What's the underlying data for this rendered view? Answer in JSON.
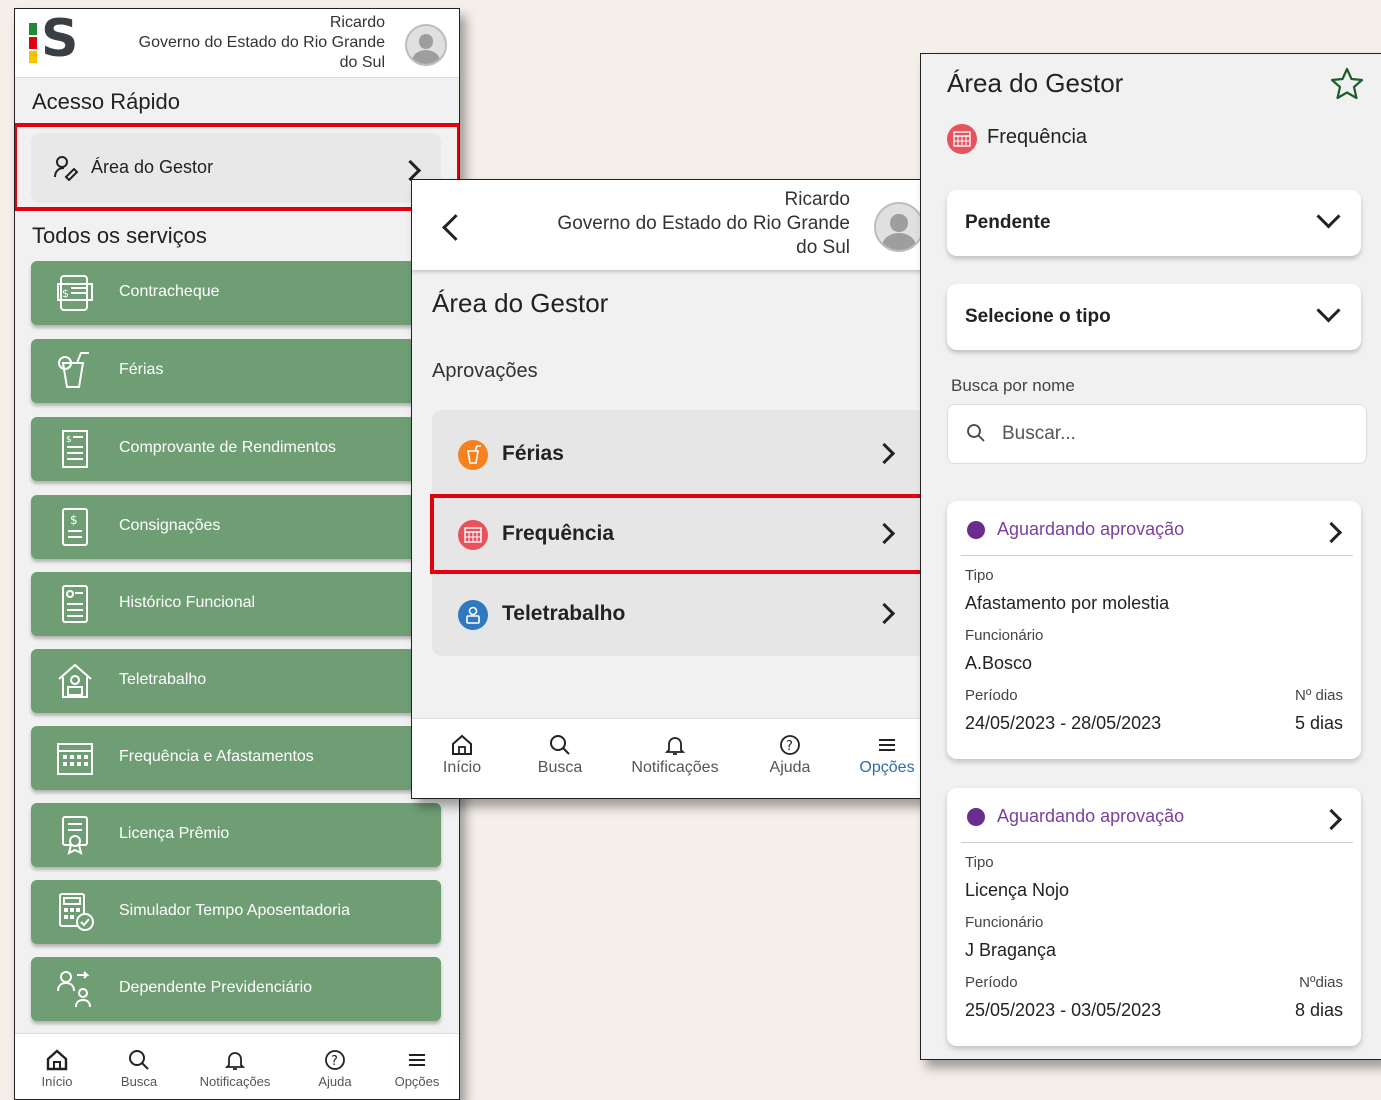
{
  "colors": {
    "service_green": "#6f9e75",
    "highlight_red": "#e3000f",
    "pending_purple": "#7b3fa0",
    "ferias_orange": "#f5821f",
    "frequencia_red": "#e8525c",
    "teletrabalho_blue": "#2e79c0"
  },
  "header": {
    "user_name": "Ricardo",
    "org_line1": "Governo do Estado do Rio Grande",
    "org_line2": "do Sul"
  },
  "home": {
    "quick_access_title": "Acesso Rápido",
    "quick_access_item": "Área do Gestor",
    "services_title": "Todos os serviços",
    "services": [
      {
        "label": "Contracheque",
        "icon": "paycheck-icon"
      },
      {
        "label": "Férias",
        "icon": "drink-icon"
      },
      {
        "label": "Comprovante de Rendimentos",
        "icon": "receipt-icon"
      },
      {
        "label": "Consignações",
        "icon": "dollar-document-icon"
      },
      {
        "label": "Histórico Funcional",
        "icon": "history-document-icon"
      },
      {
        "label": "Teletrabalho",
        "icon": "home-worker-icon"
      },
      {
        "label": "Frequência e Afastamentos",
        "icon": "calendar-icon"
      },
      {
        "label": "Licença Prêmio",
        "icon": "certificate-icon"
      },
      {
        "label": "Simulador Tempo Aposentadoria",
        "icon": "calculator-icon"
      },
      {
        "label": "Dependente Previdenciário",
        "icon": "dependents-icon"
      }
    ]
  },
  "nav": {
    "inicio": "Início",
    "busca": "Busca",
    "notificacoes": "Notificações",
    "ajuda": "Ajuda",
    "opcoes": "Opções"
  },
  "gestor": {
    "title": "Área do Gestor",
    "approvals_title": "Aprovações",
    "approvals": [
      {
        "label": "Férias",
        "icon": "drink-icon"
      },
      {
        "label": "Frequência",
        "icon": "calendar-icon"
      },
      {
        "label": "Teletrabalho",
        "icon": "home-worker-icon"
      }
    ]
  },
  "frequencia": {
    "title": "Área do Gestor",
    "subtitle": "Frequência",
    "status_dropdown": "Pendente",
    "type_dropdown": "Selecione o tipo",
    "search_label": "Busca por nome",
    "search_placeholder": "Buscar...",
    "labels": {
      "tipo": "Tipo",
      "funcionario": "Funcionário",
      "periodo": "Período"
    },
    "cards": [
      {
        "status": "Aguardando aprovação",
        "tipo": "Afastamento por molestia",
        "funcionario": "A.Bosco",
        "periodo": "24/05/2023 - 28/05/2023",
        "dias_label": "Nº dias",
        "dias": "5 dias"
      },
      {
        "status": "Aguardando aprovação",
        "tipo": "Licença Nojo",
        "funcionario": "J Bragança",
        "periodo": "25/05/2023 - 03/05/2023",
        "dias_label": "Nºdias",
        "dias": "8 dias"
      }
    ]
  }
}
